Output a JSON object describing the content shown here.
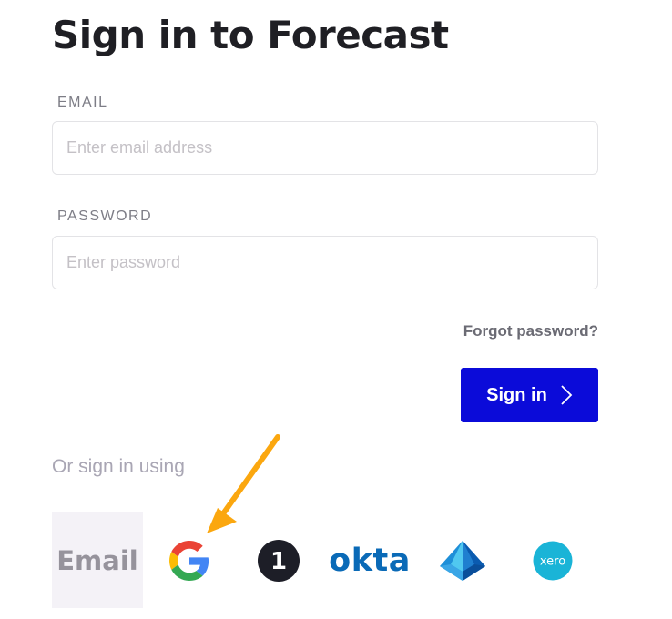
{
  "page": {
    "title": "Sign in to Forecast"
  },
  "form": {
    "email": {
      "label": "EMAIL",
      "placeholder": "Enter email address",
      "value": ""
    },
    "password": {
      "label": "PASSWORD",
      "placeholder": "Enter password",
      "value": ""
    },
    "forgot_label": "Forgot password?",
    "submit_label": "Sign in"
  },
  "alt_signin": {
    "heading": "Or sign in using",
    "providers": [
      {
        "id": "email",
        "label": "Email",
        "icon": "email-provider-icon"
      },
      {
        "id": "google",
        "label": "G",
        "icon": "google-icon",
        "colors": [
          "#4285F4",
          "#EA4335",
          "#FBBC05",
          "#34A853"
        ]
      },
      {
        "id": "onepassword",
        "label": "1",
        "icon": "onepassword-icon"
      },
      {
        "id": "okta",
        "label": "okta",
        "icon": "okta-icon"
      },
      {
        "id": "azure",
        "label": "",
        "icon": "azure-ad-icon"
      },
      {
        "id": "xero",
        "label": "xero",
        "icon": "xero-icon"
      }
    ]
  },
  "annotation": {
    "icon": "arrow-annotation",
    "color": "#FBA70F"
  },
  "colors": {
    "primary": "#0B0BD9",
    "text": "#1F1F24",
    "muted": "#7D7D86"
  }
}
